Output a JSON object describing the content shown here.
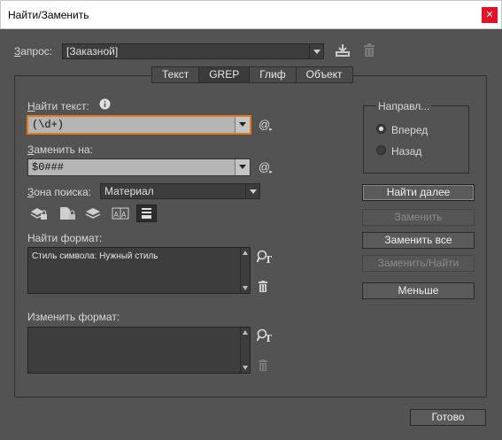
{
  "window": {
    "title": "Найти/Заменить",
    "close_glyph": "✕"
  },
  "query": {
    "label_u": "З",
    "label_rest": "апрос:",
    "value": "[Заказной]"
  },
  "tabs": [
    {
      "label": "Текст",
      "active": false
    },
    {
      "label": "GREP",
      "active": true
    },
    {
      "label": "Глиф",
      "active": false
    },
    {
      "label": "Объект",
      "active": false
    }
  ],
  "find_text": {
    "label_u": "Н",
    "label_rest": "айти текст:",
    "value": "(\\d+)"
  },
  "replace_with": {
    "label_u": "З",
    "label_rest": "аменить на:",
    "value": "$0###"
  },
  "search_zone": {
    "label_u": "З",
    "label_rest": "она поиска:",
    "value": "Материал"
  },
  "find_format": {
    "label": "Найти формат:",
    "content": "Стиль символа: Нужный стиль"
  },
  "change_format": {
    "label": "Изменить формат:",
    "content": ""
  },
  "direction": {
    "title": "Направл...",
    "options": [
      {
        "label": "Вперед",
        "selected": true
      },
      {
        "label": "Назад",
        "selected": false
      }
    ]
  },
  "buttons": {
    "find_next": "Найти далее",
    "replace": "Заменить",
    "replace_all": "Заменить все",
    "replace_find": "Заменить/Найти",
    "less": "Меньше",
    "done": "Готово"
  },
  "at_glyph": "@",
  "colors": {
    "focus": "#e07b20",
    "bg": "#535353"
  }
}
